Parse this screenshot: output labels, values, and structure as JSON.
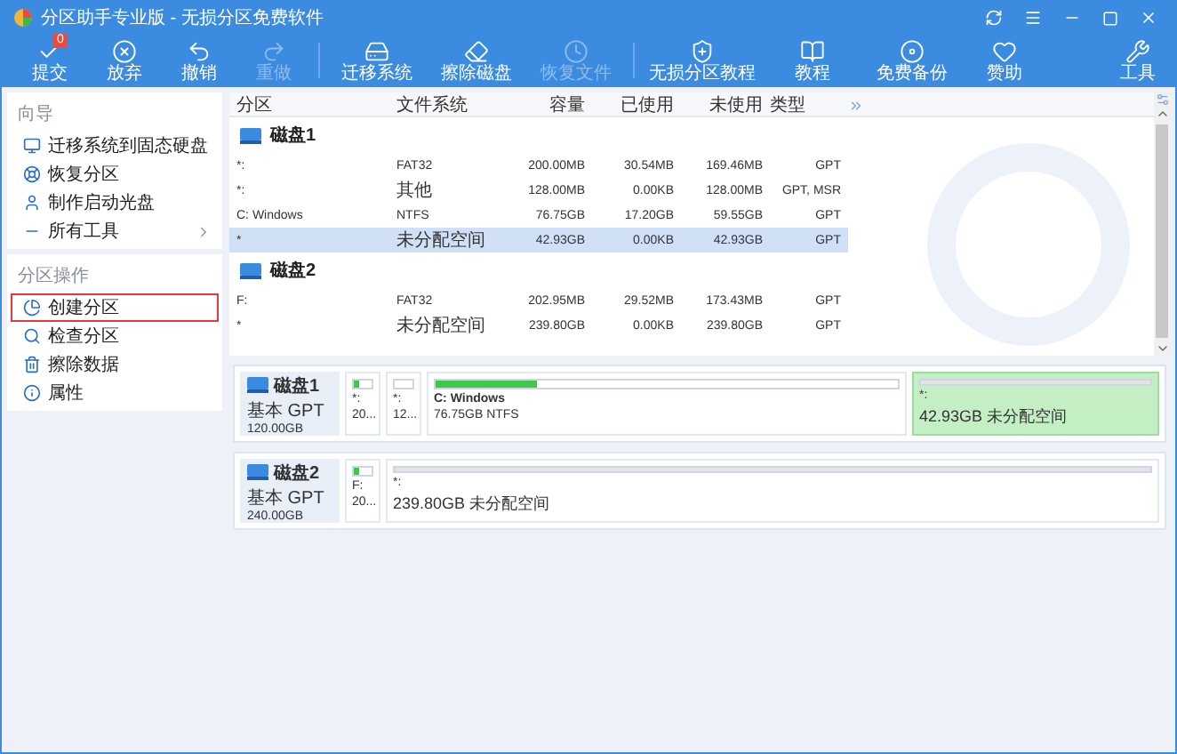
{
  "window": {
    "title": "分区助手专业版 - 无损分区免费软件"
  },
  "toolbar": [
    {
      "label": "提交",
      "disabled": false,
      "badge": "0"
    },
    {
      "label": "放弃",
      "disabled": false
    },
    {
      "label": "撤销",
      "disabled": false
    },
    {
      "label": "重做",
      "disabled": true
    },
    {
      "label": "迁移系统",
      "disabled": false
    },
    {
      "label": "擦除磁盘",
      "disabled": false
    },
    {
      "label": "恢复文件",
      "disabled": true
    },
    {
      "label": "无损分区教程",
      "disabled": false
    },
    {
      "label": "教程",
      "disabled": false
    },
    {
      "label": "免费备份",
      "disabled": false
    },
    {
      "label": "赞助",
      "disabled": false
    }
  ],
  "tools_button": {
    "label": "工具"
  },
  "sidebar": {
    "sections": [
      {
        "title": "向导",
        "items": [
          {
            "label": "迁移系统到固态硬盘",
            "selected": false,
            "has_submenu": false
          },
          {
            "label": "恢复分区",
            "selected": false,
            "has_submenu": false
          },
          {
            "label": "制作启动光盘",
            "selected": false,
            "has_submenu": false
          },
          {
            "label": "所有工具",
            "selected": false,
            "has_submenu": true
          }
        ]
      },
      {
        "title": "分区操作",
        "items": [
          {
            "label": "创建分区",
            "selected": true,
            "has_submenu": false
          },
          {
            "label": "检查分区",
            "selected": false,
            "has_submenu": false
          },
          {
            "label": "擦除数据",
            "selected": false,
            "has_submenu": false
          },
          {
            "label": "属性",
            "selected": false,
            "has_submenu": false
          }
        ]
      }
    ]
  },
  "table": {
    "columns": [
      "分区",
      "文件系统",
      "容量",
      "已使用",
      "未使用",
      "类型"
    ],
    "disks": [
      {
        "name": "磁盘1",
        "rows": [
          {
            "partition": "*:",
            "fs": "FAT32",
            "capacity": "200.00MB",
            "used": "30.54MB",
            "free": "169.46MB",
            "type": "GPT",
            "selected": false
          },
          {
            "partition": "*:",
            "fs": "其他",
            "capacity": "128.00MB",
            "used": "0.00KB",
            "free": "128.00MB",
            "type": "GPT, MSR",
            "selected": false
          },
          {
            "partition": "C: Windows",
            "fs": "NTFS",
            "capacity": "76.75GB",
            "used": "17.20GB",
            "free": "59.55GB",
            "type": "GPT",
            "selected": false
          },
          {
            "partition": "*",
            "fs": "未分配空间",
            "capacity": "42.93GB",
            "used": "0.00KB",
            "free": "42.93GB",
            "type": "GPT",
            "selected": true
          }
        ]
      },
      {
        "name": "磁盘2",
        "rows": [
          {
            "partition": "F:",
            "fs": "FAT32",
            "capacity": "202.95MB",
            "used": "29.52MB",
            "free": "173.43MB",
            "type": "GPT",
            "selected": false
          },
          {
            "partition": "*",
            "fs": "未分配空间",
            "capacity": "239.80GB",
            "used": "0.00KB",
            "free": "239.80GB",
            "type": "GPT",
            "selected": false
          }
        ]
      }
    ]
  },
  "disk_map": [
    {
      "name": "磁盘1",
      "scheme": "基本 GPT",
      "size": "120.00GB",
      "partitions": [
        {
          "kind": "small",
          "label": "*:",
          "detail": "20...",
          "level": 0.3,
          "selected": false
        },
        {
          "kind": "small",
          "label": "*:",
          "detail": "12...",
          "selected": false
        },
        {
          "kind": "primary",
          "label": "C: Windows",
          "detail": "76.75GB NTFS",
          "level": 0.22,
          "selected": false
        },
        {
          "kind": "unallocated",
          "label": "*:",
          "detail": "42.93GB 未分配空间",
          "selected": true
        }
      ]
    },
    {
      "name": "磁盘2",
      "scheme": "基本 GPT",
      "size": "240.00GB",
      "partitions": [
        {
          "kind": "small",
          "label": "F:",
          "detail": "20...",
          "level": 0.3,
          "selected": false
        },
        {
          "kind": "unallocated",
          "label": "*:",
          "detail": "239.80GB 未分配空间",
          "selected": false
        }
      ]
    }
  ]
}
